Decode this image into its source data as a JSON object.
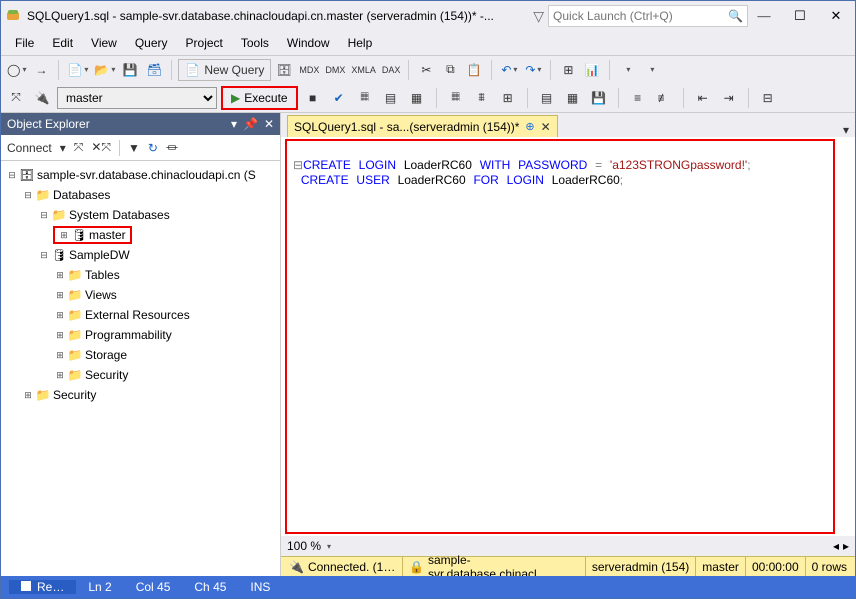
{
  "title": "SQLQuery1.sql - sample-svr.database.chinacloudapi.cn.master (serveradmin (154))* -...",
  "quick_launch_placeholder": "Quick Launch (Ctrl+Q)",
  "menus": {
    "file": "File",
    "edit": "Edit",
    "view": "View",
    "query": "Query",
    "project": "Project",
    "tools": "Tools",
    "window": "Window",
    "help": "Help"
  },
  "new_query": "New Query",
  "db_selected": "master",
  "execute_label": "Execute",
  "explorer_title": "Object Explorer",
  "connect_label": "Connect",
  "tree": {
    "server": "sample-svr.database.chinacloudapi.cn (S",
    "databases": "Databases",
    "sysdb": "System Databases",
    "master": "master",
    "sampledw": "SampleDW",
    "tables": "Tables",
    "views": "Views",
    "extres": "External Resources",
    "prog": "Programmability",
    "storage": "Storage",
    "security": "Security",
    "security2": "Security"
  },
  "tab_label": "SQLQuery1.sql - sa...(serveradmin (154))*",
  "code": {
    "l1a": "CREATE",
    "l1b": "LOGIN",
    "l1c": "LoaderRC60",
    "l1d": "WITH",
    "l1e": "PASSWORD",
    "l1f": "=",
    "l1g": "'a123STRONGpassword!'",
    "l1h": ";",
    "l2a": "CREATE",
    "l2b": "USER",
    "l2c": "LoaderRC60",
    "l2d": "FOR",
    "l2e": "LOGIN",
    "l2f": "LoaderRC60",
    "l2g": ";"
  },
  "zoom": "100 %",
  "status": {
    "connected": "Connected. (1…",
    "server": "sample-svr.database.chinacl…",
    "user": "serveradmin (154)",
    "db": "master",
    "time": "00:00:00",
    "rows": "0 rows"
  },
  "bottom": {
    "ready": "Re…",
    "ln": "Ln 2",
    "col": "Col 45",
    "ch": "Ch 45",
    "ins": "INS"
  }
}
